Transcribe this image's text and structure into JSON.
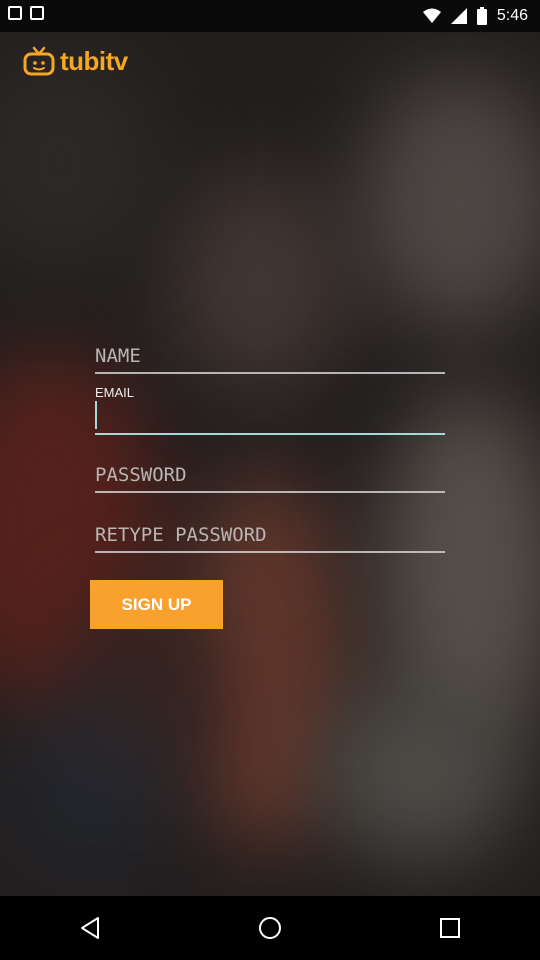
{
  "status_bar": {
    "time": "5:46",
    "icons": [
      "notification-square-icon",
      "notification-square-icon",
      "wifi-icon",
      "cell-signal-icon",
      "battery-icon"
    ]
  },
  "logo": {
    "text": "tubitv",
    "brand_color": "#f5a623"
  },
  "form": {
    "name": {
      "placeholder": "NAME",
      "value": ""
    },
    "email": {
      "label": "EMAIL",
      "value": ""
    },
    "password": {
      "placeholder": "PASSWORD",
      "value": ""
    },
    "retype_password": {
      "placeholder": "RETYPE PASSWORD",
      "value": ""
    },
    "signup_label": "SIGN UP",
    "accent_color": "#9fdcd8",
    "button_color": "#f9a12e"
  },
  "nav_bar": {
    "icons": [
      "back-icon",
      "home-icon",
      "recents-icon"
    ]
  }
}
